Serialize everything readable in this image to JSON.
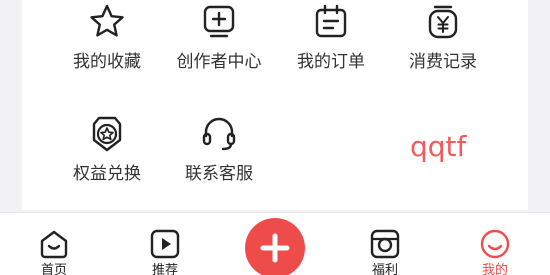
{
  "menu": {
    "items": [
      {
        "label": "我的收藏",
        "icon": "star-icon"
      },
      {
        "label": "创作者中心",
        "icon": "creator-plus-icon"
      },
      {
        "label": "我的订单",
        "icon": "order-calendar-icon"
      },
      {
        "label": "消费记录",
        "icon": "yen-jar-icon"
      },
      {
        "label": "权益兑换",
        "icon": "badge-star-icon"
      },
      {
        "label": "联系客服",
        "icon": "headset-icon"
      }
    ]
  },
  "watermark": "qqtf",
  "tabbar": {
    "tabs": [
      {
        "label": "首页",
        "icon": "home-icon"
      },
      {
        "label": "推荐",
        "icon": "play-icon"
      },
      {
        "label": "福利",
        "icon": "camera-gift-icon"
      },
      {
        "label": "我的",
        "icon": "smile-face-icon",
        "active": true
      }
    ],
    "add_icon": "plus-icon"
  },
  "colors": {
    "accent": "#ee4b4b",
    "text": "#333333",
    "background": "#f2f2f4"
  }
}
